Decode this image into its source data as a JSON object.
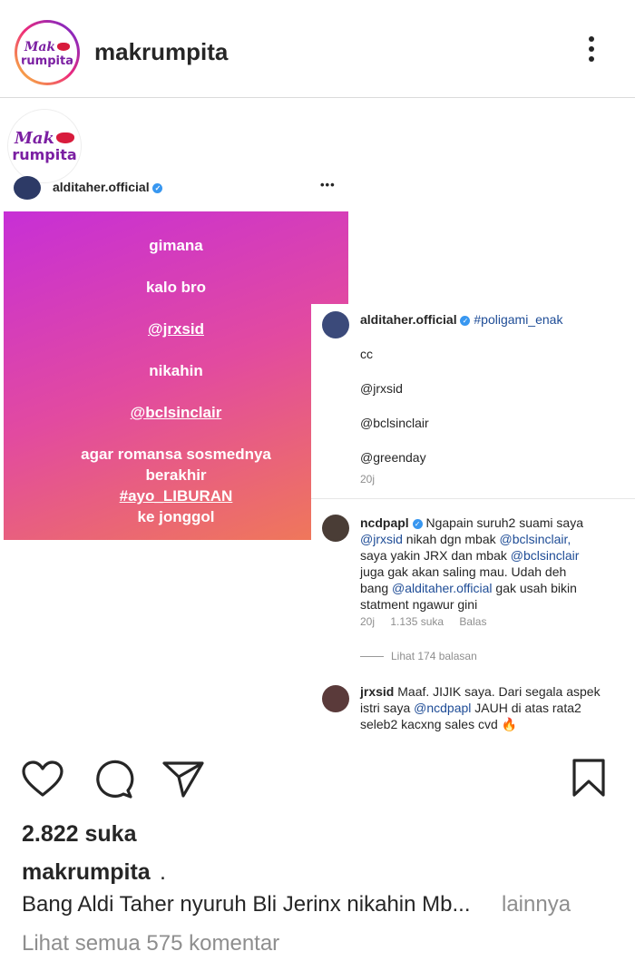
{
  "header": {
    "username": "makrumpita",
    "logo_text_top": "Mak",
    "logo_text_bottom": "rumpita"
  },
  "post": {
    "inner_username": "alditaher.official",
    "inner_more": "•••",
    "square_lines": [
      "gimana",
      "kalo bro",
      "@jrxsid",
      "nikahin",
      "@bclsinclair",
      "agar romansa sosmednya",
      "berakhir",
      "#ayo_LIBURAN",
      "ke jonggol"
    ],
    "caption_comment": {
      "user": "alditaher.official",
      "hashtag": "#poligami_enak",
      "lines": [
        "cc",
        "@jrxsid",
        "@bclsinclair",
        "@greenday"
      ],
      "time": "20j"
    },
    "reply1": {
      "user": "ncdpapl",
      "text_l1_a": "Ngapain suruh2 suami saya",
      "text_l2_a": "@jrxsid",
      "text_l2_b": "nikah dgn mbak",
      "text_l2_c": "@bclsinclair,",
      "text_l3_a": "saya yakin JRX dan mbak",
      "text_l3_b": "@bclsinclair",
      "text_l4": "juga gak akan saling mau. Udah deh",
      "text_l5_a": "bang",
      "text_l5_b": "@alditaher.official",
      "text_l5_c": "gak usah bikin",
      "text_l6": "statment ngawur gini",
      "time": "20j",
      "likes": "1.135 suka",
      "reply": "Balas",
      "view_replies": "Lihat 174 balasan"
    },
    "reply2": {
      "user": "jrxsid",
      "text_l1": "Maaf. JIJIK saya. Dari segala aspek",
      "text_l2_a": "istri saya",
      "text_l2_b": "@ncdpapl",
      "text_l2_c": "JAUH di atas rata2",
      "text_l3": "seleb2 kacxng sales cvd 🔥"
    }
  },
  "likes_text": "2.822 suka",
  "caption": {
    "username": "makrumpita",
    "suffix": ".",
    "text": "Bang Aldi Taher nyuruh Bli Jerinx nikahin Mb...",
    "more": "lainnya"
  },
  "comments_link": "Lihat semua 575 komentar",
  "icons": [
    "heart-icon",
    "comment-icon",
    "share-icon",
    "bookmark-icon",
    "more-vertical-icon",
    "verified-icon"
  ]
}
